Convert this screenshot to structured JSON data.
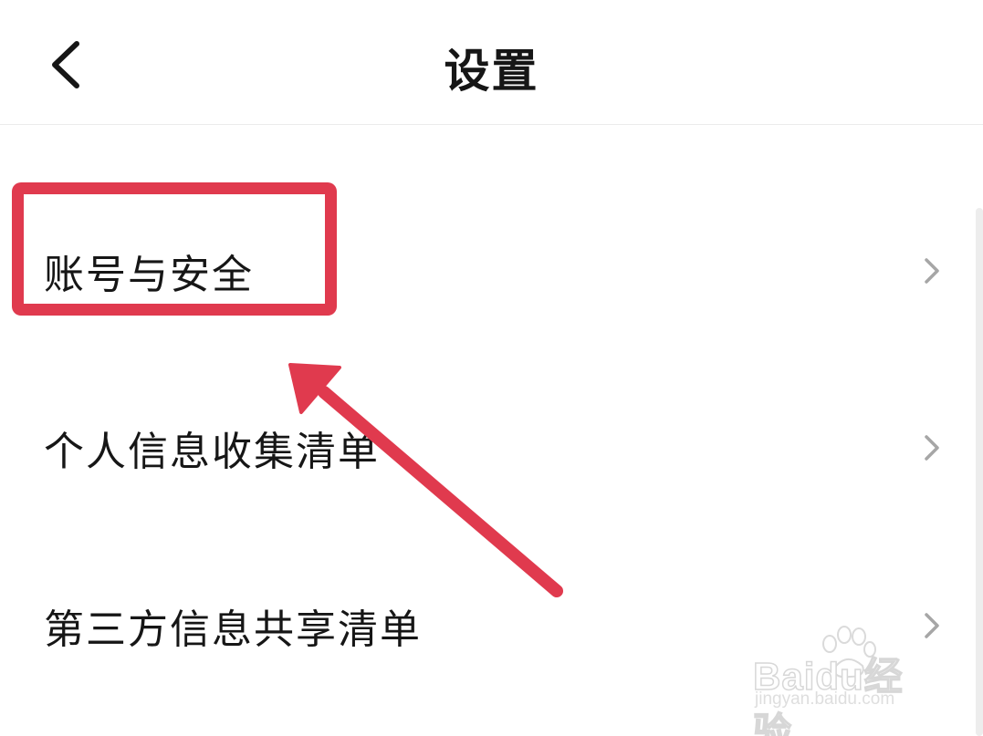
{
  "header": {
    "title": "设置",
    "back_icon": "chevron-left-icon"
  },
  "settings": {
    "items": [
      {
        "label": "账号与安全",
        "icon": "chevron-right-icon"
      },
      {
        "label": "个人信息收集清单",
        "icon": "chevron-right-icon"
      },
      {
        "label": "第三方信息共享清单",
        "icon": "chevron-right-icon"
      }
    ]
  },
  "annotation": {
    "color": "#e03a4e"
  },
  "watermark": {
    "brand": "Baidu经验",
    "url": "jingyan.baidu.com"
  },
  "colors": {
    "text": "#161616",
    "chevron": "#a6a6a6",
    "divider": "#ebebeb"
  }
}
